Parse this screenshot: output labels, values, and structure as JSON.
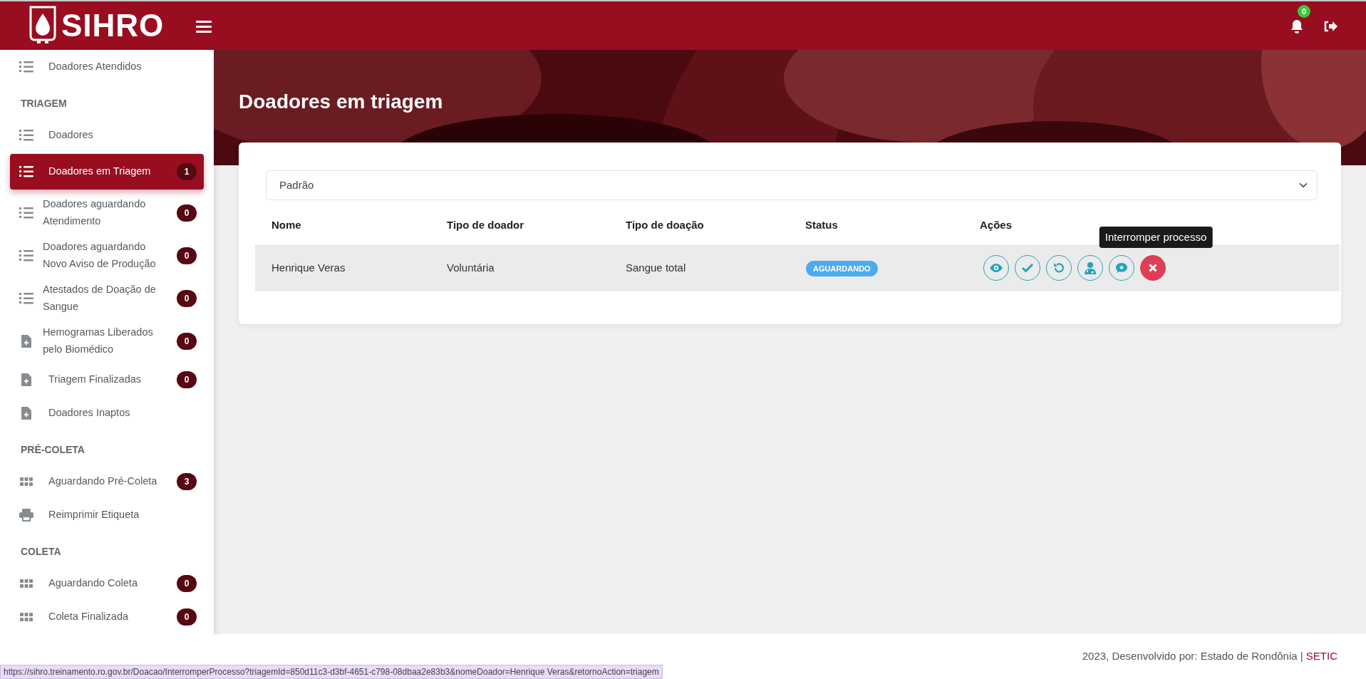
{
  "header": {
    "brand": "SIHRO",
    "notifications": "0"
  },
  "sidebar": {
    "items": [
      {
        "kind": "list",
        "label": "Doadores Atendidos",
        "selected": false
      },
      {
        "kind": "section",
        "label": "TRIAGEM"
      },
      {
        "kind": "list",
        "label": "Doadores",
        "selected": false
      },
      {
        "kind": "list",
        "label": "Doadores em Triagem",
        "badge": "1",
        "selected": true
      },
      {
        "kind": "list",
        "label": "Doadores aguardando Atendimento",
        "badge": "0",
        "selected": false
      },
      {
        "kind": "list",
        "label": "Doadores aguardando Novo Aviso de Produção",
        "badge": "0",
        "selected": false
      },
      {
        "kind": "list",
        "label": "Atestados de Doação de Sangue",
        "badge": "0",
        "selected": false
      },
      {
        "kind": "file",
        "label": "Hemogramas Liberados pelo Biomédico",
        "badge": "0",
        "selected": false
      },
      {
        "kind": "file",
        "label": "Triagem Finalizadas",
        "badge": "0",
        "selected": false
      },
      {
        "kind": "file",
        "label": "Doadores Inaptos",
        "selected": false
      },
      {
        "kind": "section",
        "label": "PRÉ-COLETA"
      },
      {
        "kind": "grid",
        "label": "Aguardando Pré-Coleta",
        "badge": "3",
        "selected": false
      },
      {
        "kind": "print",
        "label": "Reimprimir Etiqueta",
        "selected": false
      },
      {
        "kind": "section",
        "label": "COLETA"
      },
      {
        "kind": "grid",
        "label": "Aguardando Coleta",
        "badge": "0",
        "selected": false
      },
      {
        "kind": "grid",
        "label": "Coleta Finalizada",
        "badge": "0",
        "selected": false
      }
    ]
  },
  "page": {
    "title": "Doadores em triagem",
    "filter": "Padrão"
  },
  "table": {
    "columns": [
      "Nome",
      "Tipo de doador",
      "Tipo de doação",
      "Status",
      "Ações"
    ],
    "rows": [
      {
        "name": "Henrique Veras",
        "donor_type": "Voluntária",
        "donation_type": "Sangue total",
        "status": "AGUARDANDO",
        "actions": [
          {
            "kind": "view"
          },
          {
            "kind": "confirm"
          },
          {
            "kind": "undo"
          },
          {
            "kind": "doctor"
          },
          {
            "kind": "comment"
          },
          {
            "kind": "stop",
            "tooltip": "Interromper processo"
          }
        ]
      }
    ]
  },
  "footer": {
    "text": "2023, Desenvolvido por: Estado de Rondônia | ",
    "link": "SETIC"
  },
  "status_bar": {
    "url": "https://sihro.treinamento.ro.gov.br/Doacao/InterromperProcesso?triagemId=850d11c3-d3bf-4651-c798-08dbaa2e83b3&nomeDoador=Henrique Veras&retornoAction=triagem"
  }
}
